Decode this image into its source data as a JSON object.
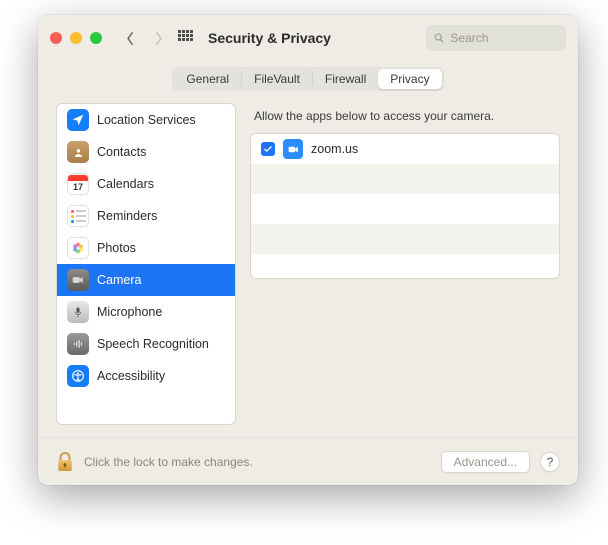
{
  "header": {
    "title": "Security & Privacy",
    "search_placeholder": "Search"
  },
  "tabs": [
    {
      "label": "General",
      "active": false
    },
    {
      "label": "FileVault",
      "active": false
    },
    {
      "label": "Firewall",
      "active": false
    },
    {
      "label": "Privacy",
      "active": true
    }
  ],
  "sidebar": {
    "items": [
      {
        "label": "Location Services",
        "icon": "location-icon",
        "selected": false
      },
      {
        "label": "Contacts",
        "icon": "contacts-icon",
        "selected": false
      },
      {
        "label": "Calendars",
        "icon": "calendar-icon",
        "selected": false
      },
      {
        "label": "Reminders",
        "icon": "reminders-icon",
        "selected": false
      },
      {
        "label": "Photos",
        "icon": "photos-icon",
        "selected": false
      },
      {
        "label": "Camera",
        "icon": "camera-icon",
        "selected": true
      },
      {
        "label": "Microphone",
        "icon": "microphone-icon",
        "selected": false
      },
      {
        "label": "Speech Recognition",
        "icon": "speech-icon",
        "selected": false
      },
      {
        "label": "Accessibility",
        "icon": "accessibility-icon",
        "selected": false
      }
    ]
  },
  "main": {
    "prompt": "Allow the apps below to access your camera.",
    "apps": [
      {
        "name": "zoom.us",
        "checked": true,
        "icon": "zoom-icon"
      }
    ]
  },
  "footer": {
    "lock_text": "Click the lock to make changes.",
    "advanced_label": "Advanced...",
    "help_label": "?"
  },
  "colors": {
    "accent": "#1e74f6",
    "window_bg": "#eeece5"
  }
}
